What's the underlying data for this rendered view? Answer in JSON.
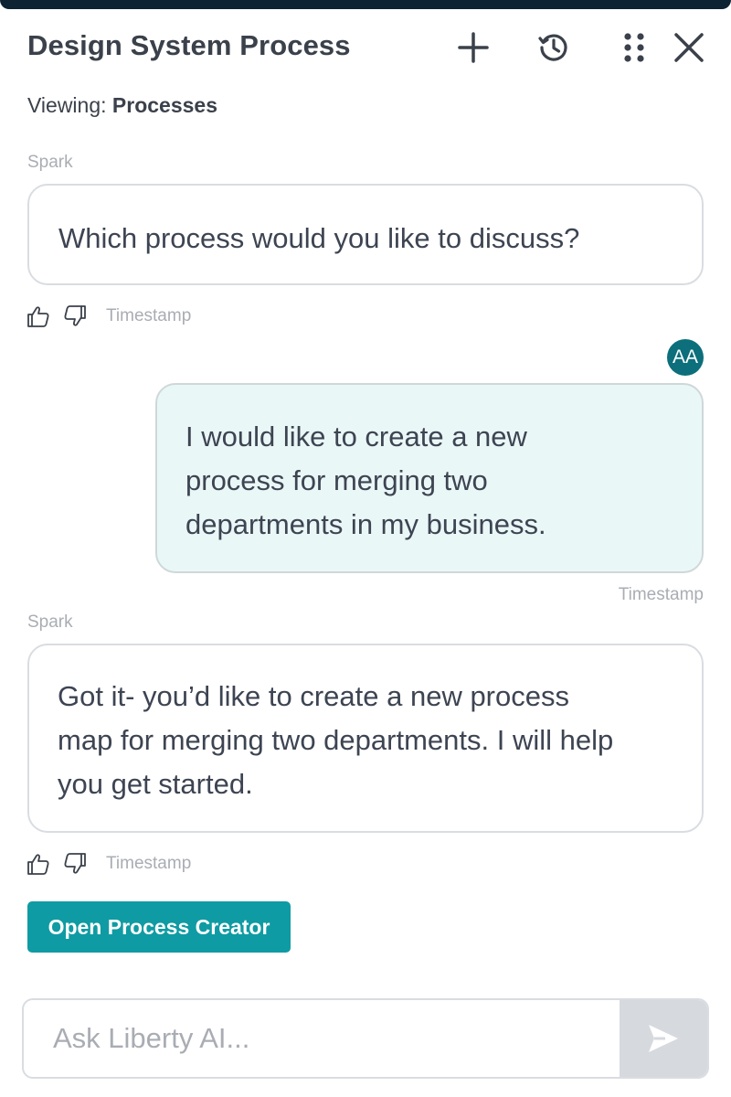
{
  "header": {
    "title": "Design System Process",
    "icons": [
      "plus-icon",
      "history-icon",
      "drag-grid-icon",
      "close-icon"
    ]
  },
  "viewing": {
    "prefix": "Viewing: ",
    "value": "Processes"
  },
  "messages": [
    {
      "sender": "Spark",
      "role": "assistant",
      "text": "Which process would you like to discuss?",
      "timestamp": "Timestamp"
    },
    {
      "sender_initials": "AA",
      "role": "user",
      "lines": [
        "I would like to create a new",
        "process for merging two",
        "departments in my business."
      ],
      "timestamp": "Timestamp"
    },
    {
      "sender": "Spark",
      "role": "assistant",
      "lines": [
        "Got it- you’d like to create a new process",
        "map for merging two departments. I will help",
        "you get started."
      ],
      "timestamp": "Timestamp"
    }
  ],
  "action_button": {
    "label": "Open Process Creator"
  },
  "composer": {
    "placeholder": "Ask Liberty AI...",
    "value": ""
  },
  "colors": {
    "accent": "#0f9ba3",
    "avatar": "#0c6f7b",
    "user_bubble": "#eaf7f7",
    "topbar": "#0d2233"
  }
}
